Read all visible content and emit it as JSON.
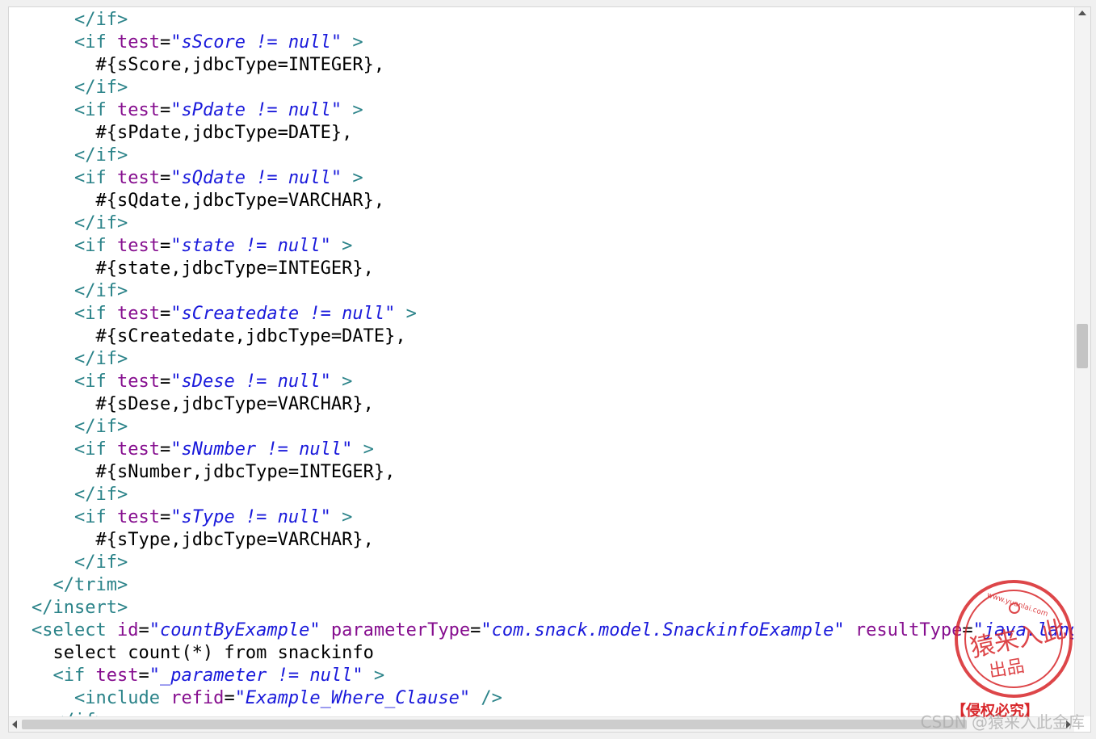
{
  "code_lines": [
    [
      "    ",
      "</if>"
    ],
    [
      "    ",
      "<if",
      " ",
      "test",
      "=",
      "\"sScore != null\"",
      " >"
    ],
    [
      "      ",
      "#{sScore,jdbcType=INTEGER},"
    ],
    [
      "    ",
      "</if>"
    ],
    [
      "    ",
      "<if",
      " ",
      "test",
      "=",
      "\"sPdate != null\"",
      " >"
    ],
    [
      "      ",
      "#{sPdate,jdbcType=DATE},"
    ],
    [
      "    ",
      "</if>"
    ],
    [
      "    ",
      "<if",
      " ",
      "test",
      "=",
      "\"sQdate != null\"",
      " >"
    ],
    [
      "      ",
      "#{sQdate,jdbcType=VARCHAR},"
    ],
    [
      "    ",
      "</if>"
    ],
    [
      "    ",
      "<if",
      " ",
      "test",
      "=",
      "\"state != null\"",
      " >"
    ],
    [
      "      ",
      "#{state,jdbcType=INTEGER},"
    ],
    [
      "    ",
      "</if>"
    ],
    [
      "    ",
      "<if",
      " ",
      "test",
      "=",
      "\"sCreatedate != null\"",
      " >"
    ],
    [
      "      ",
      "#{sCreatedate,jdbcType=DATE},"
    ],
    [
      "    ",
      "</if>"
    ],
    [
      "    ",
      "<if",
      " ",
      "test",
      "=",
      "\"sDese != null\"",
      " >"
    ],
    [
      "      ",
      "#{sDese,jdbcType=VARCHAR},"
    ],
    [
      "    ",
      "</if>"
    ],
    [
      "    ",
      "<if",
      " ",
      "test",
      "=",
      "\"sNumber != null\"",
      " >"
    ],
    [
      "      ",
      "#{sNumber,jdbcType=INTEGER},"
    ],
    [
      "    ",
      "</if>"
    ],
    [
      "    ",
      "<if",
      " ",
      "test",
      "=",
      "\"sType != null\"",
      " >"
    ],
    [
      "      ",
      "#{sType,jdbcType=VARCHAR},"
    ],
    [
      "    ",
      "</if>"
    ],
    [
      "  ",
      "</trim>"
    ],
    [
      "",
      "</insert>"
    ],
    [
      "",
      "<select",
      " ",
      "id",
      "=",
      "\"countByExample\"",
      " ",
      "parameterType",
      "=",
      "\"com.snack.model.SnackinfoExample\"",
      " ",
      "resultType",
      "=",
      "\"java.lang.",
      ""
    ],
    [
      "  ",
      "select count(*) from snackinfo"
    ],
    [
      "  ",
      "<if",
      " ",
      "test",
      "=",
      "\"_parameter != null\"",
      " >"
    ],
    [
      "    ",
      "<include",
      " ",
      "refid",
      "=",
      "\"Example_Where_Clause\"",
      " />"
    ],
    [
      "  ",
      "</if>"
    ]
  ],
  "line_types": [
    "tag",
    "attrline",
    "text",
    "tag",
    "attrline",
    "text",
    "tag",
    "attrline",
    "text",
    "tag",
    "attrline",
    "text",
    "tag",
    "attrline",
    "text",
    "tag",
    "attrline",
    "text",
    "tag",
    "attrline",
    "text",
    "tag",
    "attrline",
    "text",
    "tag",
    "tag",
    "tag",
    "multi",
    "text",
    "attrline",
    "attrline",
    "tag"
  ],
  "seal": {
    "url": "www.yuanlai.com",
    "main_text": "猿来入此",
    "sub_text": "出品",
    "caption": "【侵权必究】"
  },
  "watermark": "CSDN @猿来入此金库",
  "colors": {
    "tag": "#2b8389",
    "attribute": "#860e8f",
    "value": "#1a1adb",
    "text": "#000000",
    "seal": "#d8262a"
  }
}
